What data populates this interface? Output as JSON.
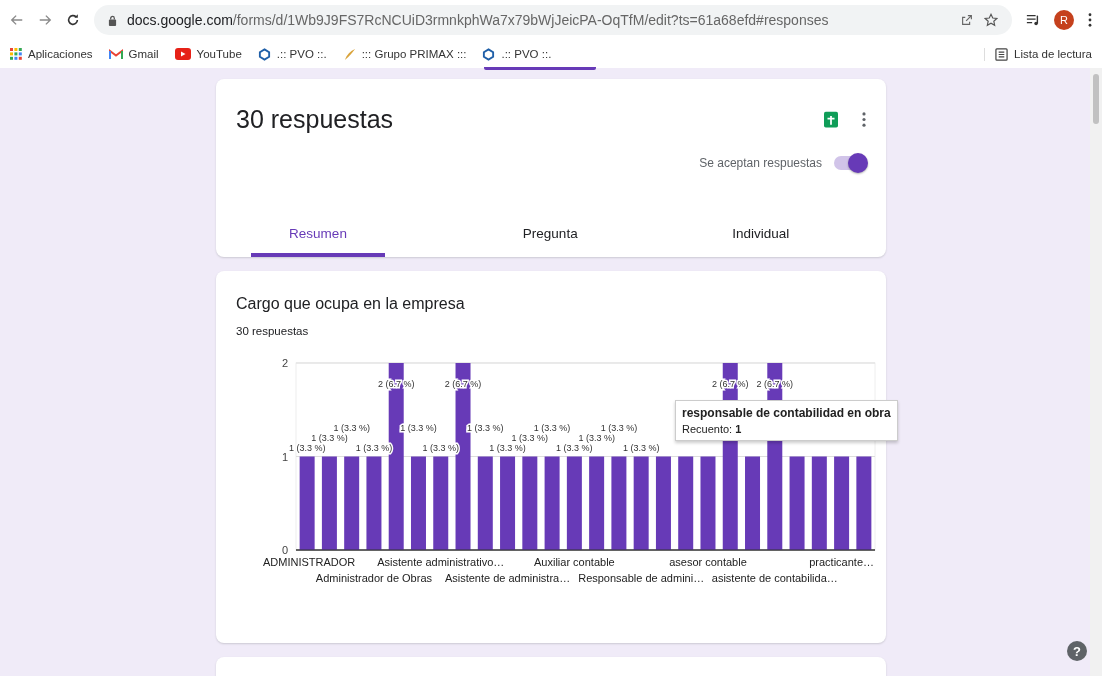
{
  "browser": {
    "url_host": "docs.google.com",
    "url_path": "/forms/d/1Wb9J9FS7RcNCUiD3rmnkphWa7x79bWjJeicPA-OqTfM/edit?ts=61a68efd#responses",
    "avatar_letter": "R"
  },
  "bookmarks": [
    {
      "kind": "apps",
      "label": "Aplicaciones"
    },
    {
      "kind": "gmail",
      "label": "Gmail"
    },
    {
      "kind": "youtube",
      "label": "YouTube"
    },
    {
      "kind": "ring",
      "label": ".:: PVO ::."
    },
    {
      "kind": "feather",
      "label": "::: Grupo PRIMAX :::"
    },
    {
      "kind": "ring",
      "label": ".:: PVO ::."
    }
  ],
  "reading_list": "Lista de lectura",
  "help_label": "?",
  "summary": {
    "title": "30 respuestas",
    "accepting": {
      "label": "Se aceptan respuestas",
      "on": true
    },
    "tabs": [
      {
        "label": "Resumen",
        "selected": true
      },
      {
        "label": "Pregunta",
        "selected": false
      },
      {
        "label": "Individual",
        "selected": false
      }
    ]
  },
  "question": {
    "title": "Cargo que ocupa en la empresa",
    "count": "30 respuestas",
    "chart_data": {
      "type": "bar",
      "ylim": [
        0,
        2
      ],
      "yticks": [
        0,
        1,
        2
      ],
      "categories": [
        "ADMINISTRADOR",
        null,
        null,
        "Administrador de Obras",
        null,
        null,
        "Asistente administrativo…",
        null,
        null,
        "Asistente de administra…",
        null,
        null,
        "Auxiliar contable",
        null,
        null,
        "Responsable de admini…",
        null,
        null,
        "asesor contable",
        null,
        null,
        "asistente de contabilida…",
        null,
        null,
        "practicante…",
        null
      ],
      "series": [
        {
          "color": "#673ab7",
          "values": [
            1,
            1,
            1,
            1,
            2,
            1,
            1,
            2,
            1,
            1,
            1,
            1,
            1,
            1,
            1,
            1,
            1,
            1,
            1,
            2,
            1,
            2,
            1,
            1,
            1,
            1
          ]
        }
      ],
      "value_labels": [
        "1 (3.3 %)",
        "1 (3.3 %)",
        "1 (3.3 %)",
        "1 (3.3 %)",
        "2 (6.7 %)",
        "1 (3.3 %)",
        "1 (3.3 %)",
        "2 (6.7 %)",
        "1 (3.3 %)",
        "1 (3.3 %)",
        "1 (3.3 %)",
        "1 (3.3 %)",
        "1 (3.3 %)",
        "1 (3.3 %)",
        "1 (3.3 %)",
        "1 (3.3 %)",
        null,
        null,
        null,
        "2 (6.7 %)",
        null,
        "2 (6.7 %)",
        null,
        null,
        null,
        null
      ]
    },
    "tooltip": {
      "title": "responsable de contabilidad en obra",
      "text": "Recuento: **1**"
    }
  }
}
